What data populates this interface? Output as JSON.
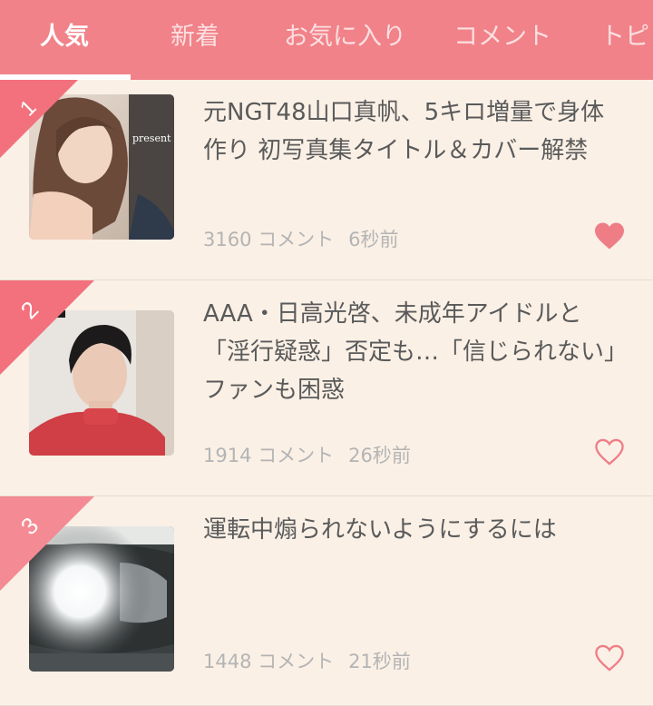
{
  "tabs": [
    {
      "label": "人気",
      "active": true
    },
    {
      "label": "新着",
      "active": false
    },
    {
      "label": "お気に入り",
      "active": false
    },
    {
      "label": "コメント",
      "active": false
    },
    {
      "label": "トピ",
      "active": false
    }
  ],
  "articles": [
    {
      "rank": "1",
      "title": "元NGT48山口真帆、5キロ増量で身体作り 初写真集タイトル＆カバー解禁",
      "comments": "3160 コメント",
      "time": "6秒前",
      "favorited": true,
      "thumb_text": "present"
    },
    {
      "rank": "2",
      "title": "AAA・日高光啓、未成年アイドルと「淫行疑惑」否定も…「信じられない」ファンも困惑",
      "comments": "1914 コメント",
      "time": "26秒前",
      "favorited": false
    },
    {
      "rank": "3",
      "title": "運転中煽られないようにするには",
      "comments": "1448 コメント",
      "time": "21秒前",
      "favorited": false
    }
  ],
  "colors": {
    "accent": "#f18289",
    "background": "#faf0e6",
    "ribbon": "#f2717d",
    "heart": "#ef7d86"
  },
  "icons": {
    "favorite_on": "heart-filled-icon",
    "favorite_off": "heart-outline-icon"
  }
}
